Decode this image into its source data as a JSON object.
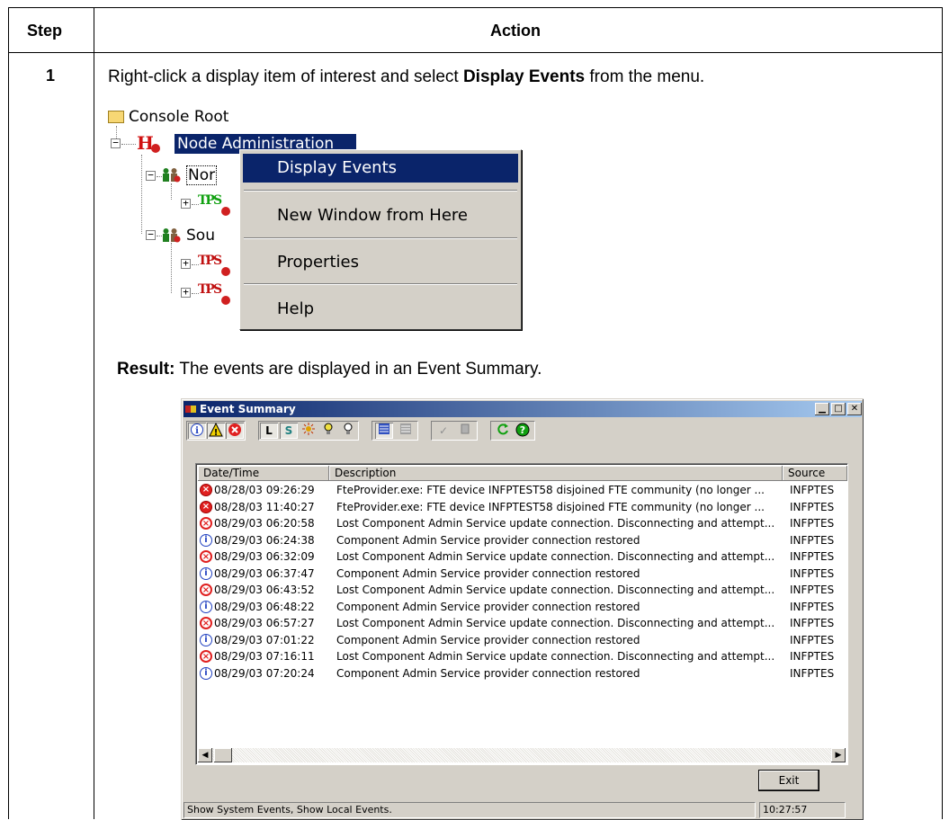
{
  "table": {
    "header_step": "Step",
    "header_action": "Action",
    "row_step": "1",
    "instruction_prefix": "Right-click a display item of interest and select ",
    "instruction_bold": "Display Events",
    "instruction_suffix": " from the menu.",
    "result_label": "Result:",
    "result_text": " The events are displayed in an Event Summary."
  },
  "tree": {
    "root": "Console Root",
    "node_admin": "Node Administration",
    "child1": "Nor",
    "child2": "Sou"
  },
  "context_menu": {
    "items": [
      "Display Events",
      "New Window from Here",
      "Properties",
      "Help"
    ],
    "selected": "Display Events"
  },
  "window": {
    "title": "Event Summary",
    "columns": [
      "Date/Time",
      "Description",
      "Source"
    ],
    "rows": [
      {
        "icon": "fte-error",
        "dt": "08/28/03 09:26:29",
        "desc": "FteProvider.exe: FTE device INFPTEST58 disjoined FTE community (no longer ...",
        "src": "INFPTES"
      },
      {
        "icon": "fte-error",
        "dt": "08/28/03 11:40:27",
        "desc": "FteProvider.exe: FTE device INFPTEST58 disjoined FTE community (no longer ...",
        "src": "INFPTES"
      },
      {
        "icon": "error",
        "dt": "08/29/03 06:20:58",
        "desc": "Lost Component Admin Service update connection.  Disconnecting and attempt...",
        "src": "INFPTES"
      },
      {
        "icon": "info",
        "dt": "08/29/03 06:24:38",
        "desc": "Component Admin Service provider connection restored",
        "src": "INFPTES"
      },
      {
        "icon": "error",
        "dt": "08/29/03 06:32:09",
        "desc": "Lost Component Admin Service update connection.  Disconnecting and attempt...",
        "src": "INFPTES"
      },
      {
        "icon": "info",
        "dt": "08/29/03 06:37:47",
        "desc": "Component Admin Service provider connection restored",
        "src": "INFPTES"
      },
      {
        "icon": "error",
        "dt": "08/29/03 06:43:52",
        "desc": "Lost Component Admin Service update connection.  Disconnecting and attempt...",
        "src": "INFPTES"
      },
      {
        "icon": "info",
        "dt": "08/29/03 06:48:22",
        "desc": "Component Admin Service provider connection restored",
        "src": "INFPTES"
      },
      {
        "icon": "error",
        "dt": "08/29/03 06:57:27",
        "desc": "Lost Component Admin Service update connection.  Disconnecting and attempt...",
        "src": "INFPTES"
      },
      {
        "icon": "info",
        "dt": "08/29/03 07:01:22",
        "desc": "Component Admin Service provider connection restored",
        "src": "INFPTES"
      },
      {
        "icon": "error",
        "dt": "08/29/03 07:16:11",
        "desc": "Lost Component Admin Service update connection.  Disconnecting and attempt...",
        "src": "INFPTES"
      },
      {
        "icon": "info",
        "dt": "08/29/03 07:20:24",
        "desc": "Component Admin Service provider connection restored",
        "src": "INFPTES"
      }
    ],
    "exit_label": "Exit",
    "status_text": "Show System Events, Show Local Events.",
    "status_time": "10:27:57",
    "toolbar_letter_l": "L",
    "toolbar_letter_s": "S"
  },
  "colors": {
    "selection": "#0a246a",
    "error_red": "#e02020",
    "info_blue": "#2040c0",
    "face": "#d4d0c8"
  }
}
